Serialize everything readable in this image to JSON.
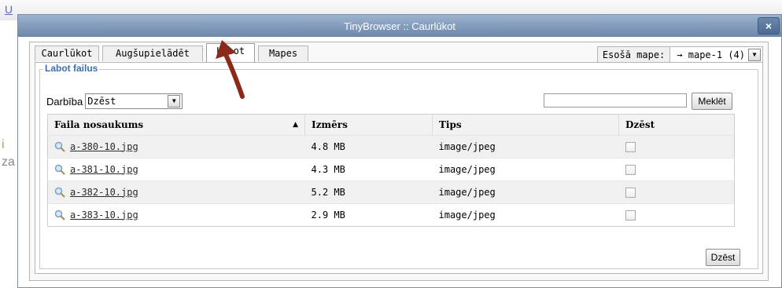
{
  "background": {
    "toolbar_letter": "U",
    "left_char_1": "i",
    "left_char_2": "za"
  },
  "dialog": {
    "title": "TinyBrowser :: Caurlūkot",
    "close_label": "×",
    "tabs": [
      {
        "label": "Caurlūkot",
        "active": false
      },
      {
        "label": "Augšupielādēt",
        "active": false
      },
      {
        "label": "Labot",
        "active": true
      },
      {
        "label": "Mapes",
        "active": false
      }
    ],
    "current_folder": {
      "label": "Esošā mape:",
      "value": "→ mape-1 (4)"
    },
    "section_title": "Labot failus",
    "action": {
      "label": "Darbība",
      "selected": "Dzēst"
    },
    "search": {
      "value": "",
      "button": "Meklēt"
    },
    "table": {
      "columns": [
        "Faila nosaukums",
        "Izmērs",
        "Tips",
        "Dzēst"
      ],
      "sort_indicator": "▲",
      "rows": [
        {
          "name": "a-380-10.jpg",
          "size": "4.8 MB",
          "type": "image/jpeg",
          "checked": false
        },
        {
          "name": "a-381-10.jpg",
          "size": "4.3 MB",
          "type": "image/jpeg",
          "checked": false
        },
        {
          "name": "a-382-10.jpg",
          "size": "5.2 MB",
          "type": "image/jpeg",
          "checked": false
        },
        {
          "name": "a-383-10.jpg",
          "size": "2.9 MB",
          "type": "image/jpeg",
          "checked": false
        }
      ]
    },
    "delete_button": "Dzēst"
  },
  "colors": {
    "titlebar": "#7b95b8",
    "legend": "#3a6fb0",
    "annotation_arrow": "#8b2a1a"
  }
}
